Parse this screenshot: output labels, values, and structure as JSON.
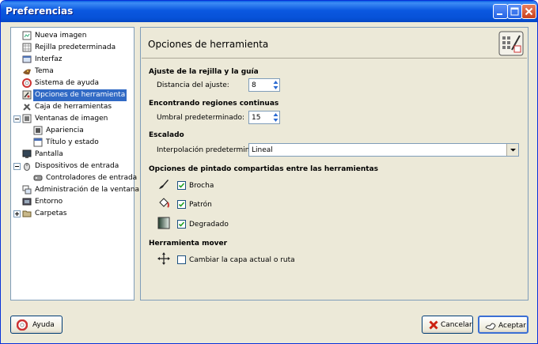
{
  "window": {
    "title": "Preferencias"
  },
  "tree": {
    "items": [
      {
        "label": "Nueva imagen"
      },
      {
        "label": "Rejilla predeterminada"
      },
      {
        "label": "Interfaz"
      },
      {
        "label": "Tema"
      },
      {
        "label": "Sistema de ayuda"
      },
      {
        "label": "Opciones de herramienta"
      },
      {
        "label": "Caja de herramientas"
      },
      {
        "label": "Ventanas de imagen"
      },
      {
        "label": "Apariencia"
      },
      {
        "label": "Título y estado"
      },
      {
        "label": "Pantalla"
      },
      {
        "label": "Dispositivos de entrada"
      },
      {
        "label": "Controladores de entrada"
      },
      {
        "label": "Administración de la ventana"
      },
      {
        "label": "Entorno"
      },
      {
        "label": "Carpetas"
      }
    ]
  },
  "panel": {
    "title": "Opciones de herramienta",
    "grid": {
      "section": "Ajuste de la rejilla y la guía",
      "label": "Distancia del ajuste:",
      "value": "8"
    },
    "regions": {
      "section": "Encontrando regiones continuas",
      "label": "Umbral predeterminado:",
      "value": "15"
    },
    "scaling": {
      "section": "Escalado",
      "label": "Interpolación predeterminada:",
      "value": "Lineal"
    },
    "paint": {
      "section": "Opciones de pintado compartidas entre las herramientas",
      "brush": "Brocha",
      "pattern": "Patrón",
      "gradient": "Degradado"
    },
    "move": {
      "section": "Herramienta mover",
      "label": "Cambiar la capa actual o ruta"
    }
  },
  "buttons": {
    "help": "Ayuda",
    "cancel": "Cancelar",
    "accept": "Aceptar"
  }
}
